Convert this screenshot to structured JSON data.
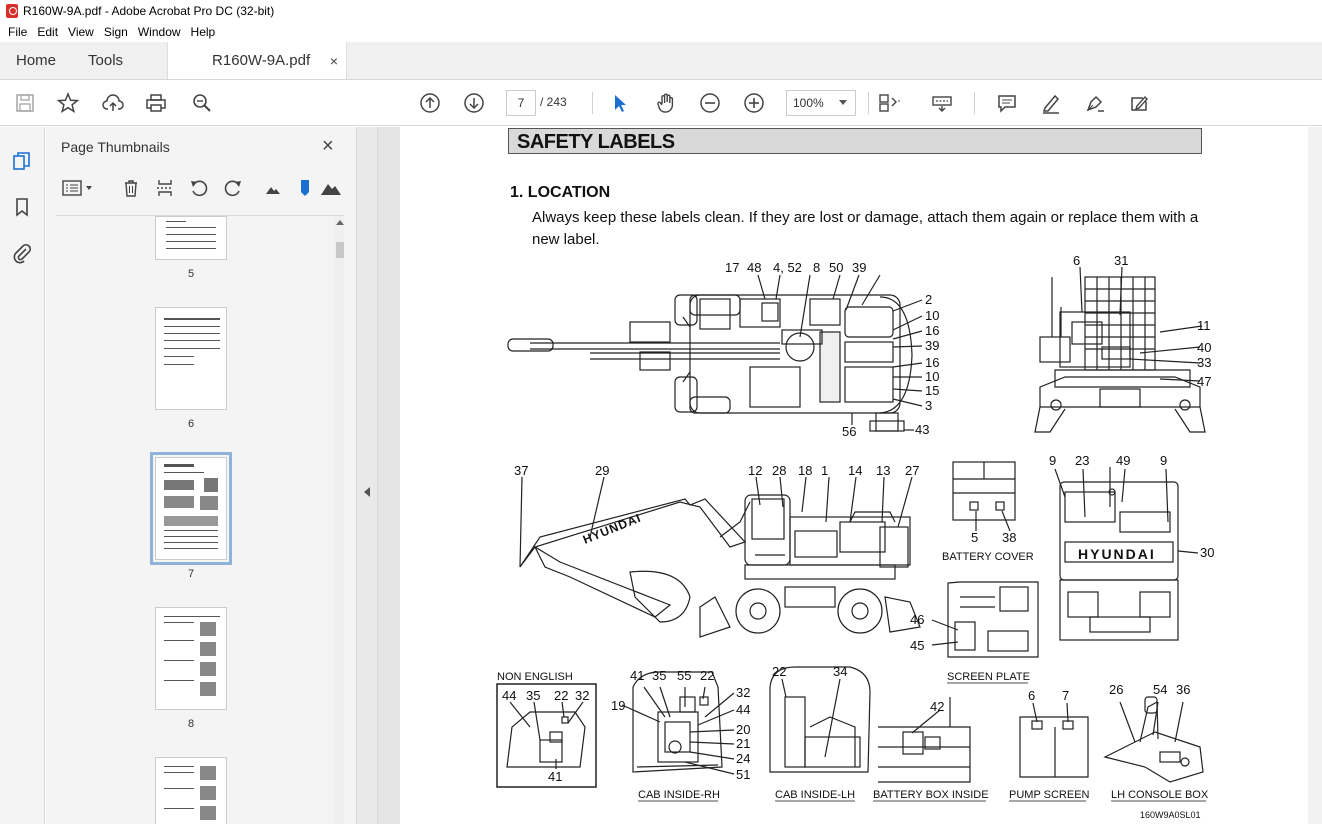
{
  "window": {
    "title": "R160W-9A.pdf - Adobe Acrobat Pro DC (32-bit)"
  },
  "menu": [
    "File",
    "Edit",
    "View",
    "Sign",
    "Window",
    "Help"
  ],
  "tabs": {
    "home": "Home",
    "tools": "Tools",
    "document": "R160W-9A.pdf",
    "close": "×"
  },
  "toolbar": {
    "current_page": "7",
    "total_pages": "/ 243",
    "zoom": "100%"
  },
  "thumbnails": {
    "title": "Page Thumbnails",
    "close": "×",
    "pages": [
      {
        "label": "5"
      },
      {
        "label": "6"
      },
      {
        "label": "7"
      },
      {
        "label": "8"
      },
      {
        "label": ""
      }
    ]
  },
  "document": {
    "heading": "SAFETY LABELS",
    "section_title": "1.  LOCATION",
    "section_text": "Always keep these labels clean.  If they are lost or damage, attach them again or replace them with a new label.",
    "top_view_labels": [
      "17",
      "48",
      "4, 52",
      "8",
      "50",
      "39",
      "2",
      "10",
      "16",
      "39",
      "16",
      "10",
      "15",
      "3",
      "56",
      "43"
    ],
    "rear_view_labels": [
      "6",
      "31",
      "11",
      "40",
      "33",
      "47"
    ],
    "side_view_labels": [
      "37",
      "29",
      "12",
      "28",
      "18",
      "1",
      "14",
      "13",
      "27",
      "46",
      "45"
    ],
    "battery_cover": {
      "caption": "BATTERY COVER",
      "labels": [
        "5",
        "38"
      ]
    },
    "screen_plate": {
      "caption": "SCREEN PLATE"
    },
    "front_view_labels": [
      "9",
      "23",
      "49",
      "9",
      "30"
    ],
    "non_english": {
      "caption": "NON ENGLISH",
      "labels": [
        "44",
        "35",
        "22",
        "32",
        "41"
      ]
    },
    "cab_rh": {
      "caption": "CAB INSIDE-RH",
      "labels": [
        "41",
        "35",
        "55",
        "22",
        "32",
        "44",
        "19",
        "20",
        "21",
        "24",
        "51"
      ]
    },
    "cab_lh": {
      "caption": "CAB INSIDE-LH",
      "labels": [
        "22",
        "34"
      ]
    },
    "battery_box": {
      "caption": "BATTERY BOX INSIDE",
      "labels": [
        "42"
      ]
    },
    "pump_screen": {
      "caption": "PUMP SCREEN",
      "labels": [
        "6",
        "7"
      ]
    },
    "lh_console": {
      "caption": "LH CONSOLE BOX",
      "labels": [
        "26",
        "54",
        "36"
      ]
    },
    "figure_code": "160W9A0SL01"
  }
}
